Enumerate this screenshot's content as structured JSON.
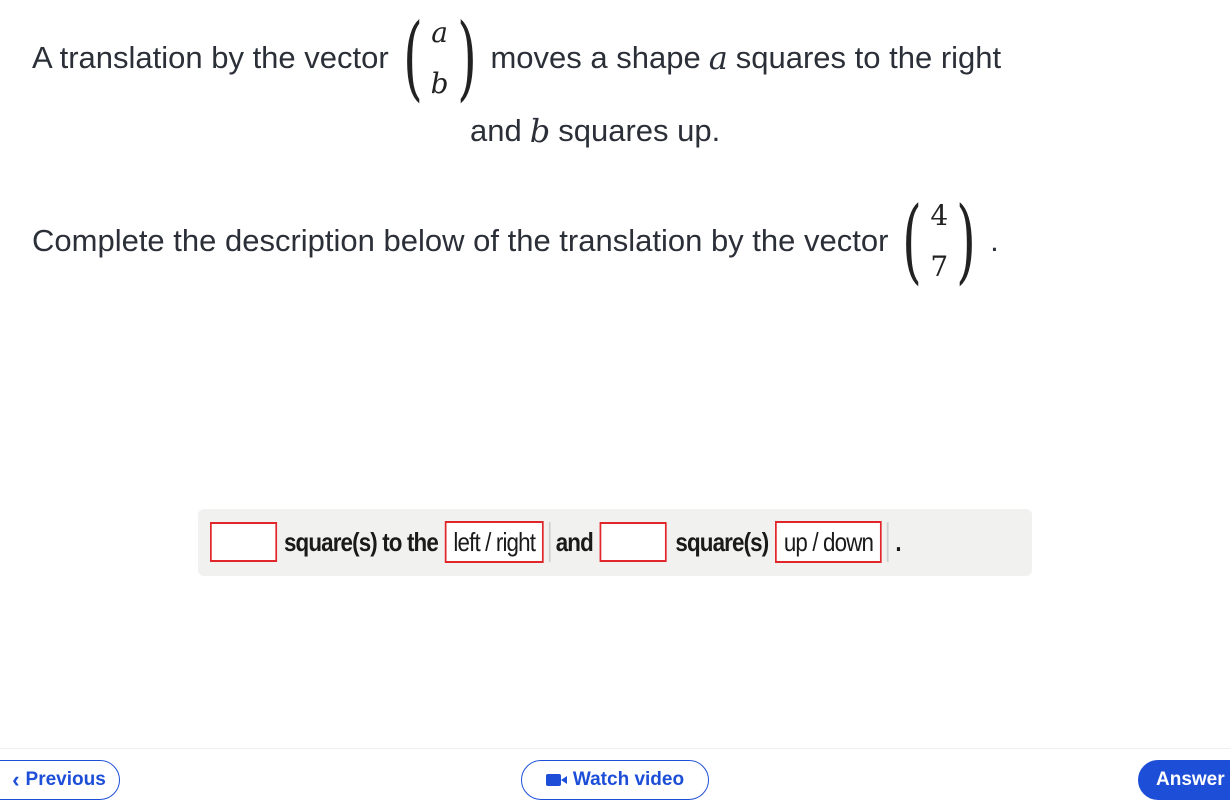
{
  "question": {
    "line1_prefix": "A translation by the vector",
    "vector1_top": "a",
    "vector1_bottom": "b",
    "line1_mid": "moves a shape",
    "var_a": "a",
    "line1_suffix": "squares to the right",
    "line2_prefix": "and",
    "var_b": "b",
    "line2_suffix": "squares up.",
    "line3_prefix": "Complete the description below of the translation by the vector",
    "vector2_top": "4",
    "vector2_bottom": "7",
    "line3_suffix": "."
  },
  "answer_row": {
    "text1": "square(s) to the",
    "choice1": "left / right",
    "text2": "and",
    "text3": "square(s)",
    "choice2": "up / down",
    "end": "."
  },
  "footer": {
    "previous_label": "Previous",
    "watch_video_label": "Watch video",
    "answer_label": "Answer"
  },
  "colors": {
    "accent": "#1d4ed8",
    "input_border": "#e0262b",
    "panel_bg": "#f1f1ef"
  }
}
